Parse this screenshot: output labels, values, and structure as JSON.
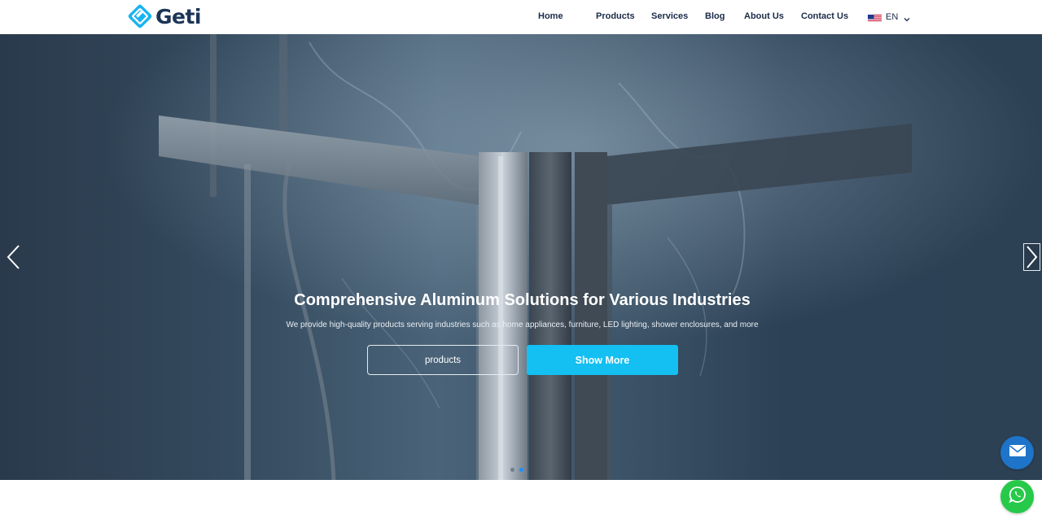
{
  "brand": {
    "name": "Geti",
    "logo_icon": "geti-logo-icon",
    "colors": {
      "primary": "#1d3557",
      "accent": "#14bff2"
    }
  },
  "nav": {
    "items": [
      {
        "label": "Home"
      },
      {
        "label": "Products"
      },
      {
        "label": "Services"
      },
      {
        "label": "Blog"
      },
      {
        "label": "About Us"
      },
      {
        "label": "Contact Us"
      }
    ],
    "language": {
      "label": "EN",
      "flag_icon": "us-flag-icon",
      "chevron_icon": "chevron-down-icon"
    }
  },
  "hero": {
    "title": "Comprehensive Aluminum Solutions for Various Industries",
    "subtitle": "We provide high-quality products serving industries such as home appliances, furniture, LED lighting, shower enclosures, and more",
    "buttons": {
      "products_label": "products",
      "show_more_label": "Show More"
    },
    "prev_icon": "chevron-left-icon",
    "next_icon": "chevron-right-icon",
    "slides": {
      "count": 2,
      "active": 2
    }
  },
  "floating": {
    "mail_icon": "mail-icon",
    "whatsapp_icon": "whatsapp-icon"
  }
}
